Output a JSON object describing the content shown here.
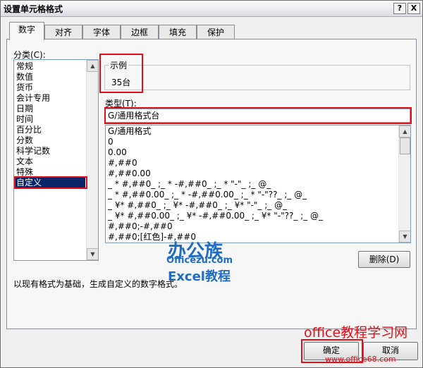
{
  "window": {
    "title": "设置单元格格式",
    "help_btn": "?",
    "close_btn": "X"
  },
  "tabs": [
    {
      "label": "数字"
    },
    {
      "label": "对齐"
    },
    {
      "label": "字体"
    },
    {
      "label": "边框"
    },
    {
      "label": "填充"
    },
    {
      "label": "保护"
    }
  ],
  "category": {
    "label": "分类(C):",
    "items": [
      "常规",
      "数值",
      "货币",
      "会计专用",
      "日期",
      "时间",
      "百分比",
      "分数",
      "科学记数",
      "文本",
      "特殊",
      "自定义"
    ],
    "selected": "自定义"
  },
  "sample": {
    "label": "示例",
    "value": "35台"
  },
  "type": {
    "label": "类型(T):",
    "value": "G/通用格式台",
    "formats": [
      "G/通用格式",
      "0",
      "0.00",
      "#,##0",
      "#,##0.00",
      "_ * #,##0_ ;_ * -#,##0_ ;_ * \"-\"_ ;_ @_",
      "_ * #,##0.00_ ;_ * -#,##0.00_ ;_ * \"-\"??_ ;_ @_",
      "_ ¥* #,##0_ ;_ ¥* -#,##0_ ;_ ¥* \"-\"_ ;_ @_",
      "_ ¥* #,##0.00_ ;_ ¥* -#,##0.00_ ;_ ¥* \"-\"??_ ;_ @_",
      "#,##0;-#,##0",
      "#,##0;[红色]-#,##0"
    ]
  },
  "delete_label": "删除(D)",
  "description": "以现有格式为基础，生成自定义的数字格式。",
  "ok_label": "确定",
  "cancel_label": "取消",
  "watermark": {
    "logo": "办公族",
    "site": "Officezu.com",
    "excel": "Excel教程",
    "brand": "office教程学习网",
    "url": "www.office68.com"
  },
  "colors": {
    "selection": "#0a246a",
    "highlight": "#e0101a",
    "watermark_blue": "#1e6cc4"
  }
}
